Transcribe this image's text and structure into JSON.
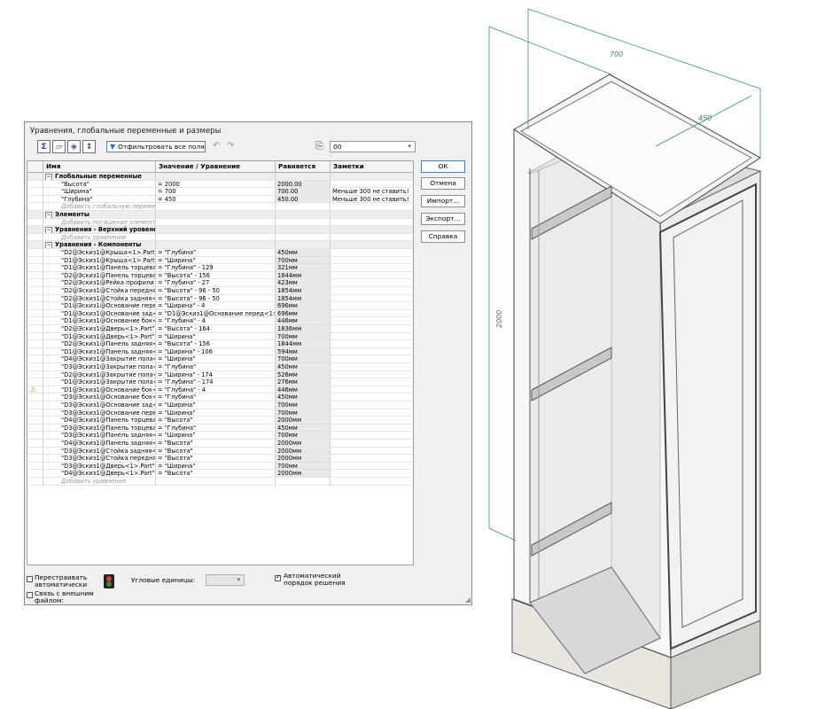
{
  "viewport": {
    "dim_width": "700",
    "dim_depth": "450",
    "dim_height": "2000",
    "accent_color": "#3a8a8a"
  },
  "dialog": {
    "title": "Уравнения, глобальные переменные и размеры",
    "toolbar": {
      "view_equations_icon": "sigma-icon",
      "view_sketch_icon": "sketch-view-icon",
      "view_dims_icon": "dimension-view-icon",
      "view_order_icon": "order-view-icon",
      "filter_label": "Отфильтровать все поля",
      "undo_icon": "undo-icon",
      "redo_icon": "redo-icon",
      "units_icon": "units-icon",
      "units_value": "00"
    },
    "columns": {
      "name": "Имя",
      "value": "Значение / Уравнение",
      "evaluates": "Равняется",
      "notes": "Заметки"
    },
    "rows": [
      {
        "type": "section",
        "name": "Глобальные переменные",
        "value": "",
        "eval": "",
        "notes": ""
      },
      {
        "type": "row",
        "name": "\"Высота\"",
        "value": "= 2000",
        "eval": "2000.00",
        "notes": ""
      },
      {
        "type": "row",
        "name": "\"Ширина\"",
        "value": "= 700",
        "eval": "700.00",
        "notes": "Меньше 300 не ставить!"
      },
      {
        "type": "row",
        "name": "\"Глубина\"",
        "value": "= 450",
        "eval": "450.00",
        "notes": "Меньше 300 не ставить!"
      },
      {
        "type": "add",
        "name": "Добавить глобальную перемен",
        "value": "",
        "eval": "",
        "notes": ""
      },
      {
        "type": "section",
        "name": "Элементы",
        "value": "",
        "eval": "",
        "notes": ""
      },
      {
        "type": "add",
        "name": "Добавить погашение элемента",
        "value": "",
        "eval": "",
        "notes": ""
      },
      {
        "type": "section",
        "name": "Уравнения - Верхний уровень",
        "value": "",
        "eval": "",
        "notes": ""
      },
      {
        "type": "add",
        "name": "Добавить уравнение",
        "value": "",
        "eval": "",
        "notes": ""
      },
      {
        "type": "section",
        "name": "Уравнения - Компоненты",
        "value": "",
        "eval": "",
        "notes": ""
      },
      {
        "type": "row",
        "name": "\"D2@Эскиз1@Крыша<1>.Part@",
        "value": "= \"Глубина\"",
        "eval": "450мм",
        "notes": ""
      },
      {
        "type": "row",
        "name": "\"D1@Эскиз1@Крыша<1>.Part@",
        "value": "= \"Ширина\"",
        "eval": "700мм",
        "notes": ""
      },
      {
        "type": "row",
        "name": "\"D1@Эскиз1@Панель торцева",
        "value": "= \"Глубина\" - 129",
        "eval": "321мм",
        "notes": ""
      },
      {
        "type": "row",
        "name": "\"D2@Эскиз1@Панель торцева",
        "value": "= \"Высота\" - 156",
        "eval": "1844мм",
        "notes": ""
      },
      {
        "type": "row",
        "name": "\"D2@Эскиз1@Рейка профили",
        "value": "= \"Глубина\" - 27",
        "eval": "423мм",
        "notes": ""
      },
      {
        "type": "row",
        "name": "\"D2@Эскиз1@Стойка передня",
        "value": "= \"Высота\" - 96 - 50",
        "eval": "1854мм",
        "notes": ""
      },
      {
        "type": "row",
        "name": "\"D2@Эскиз1@Стойка задняя<",
        "value": "= \"Высота\" - 96 - 50",
        "eval": "1854мм",
        "notes": ""
      },
      {
        "type": "row",
        "name": "\"D1@Эскиз1@Основание пере",
        "value": "= \"Ширина\" - 4",
        "eval": "696мм",
        "notes": ""
      },
      {
        "type": "row",
        "name": "\"D1@Эскиз1@Основание зад<",
        "value": "= \"D1@Эскиз1@Основание перед<1>.",
        "eval": "696мм",
        "notes": ""
      },
      {
        "type": "row",
        "name": "\"D1@Эскиз1@Основание бок<",
        "value": "= \"Глубина\" - 4",
        "eval": "446мм",
        "notes": ""
      },
      {
        "type": "row",
        "name": "\"D2@Эскиз1@Дверь<1>.Part\"",
        "value": "= \"Высота\" - 164",
        "eval": "1836мм",
        "notes": ""
      },
      {
        "type": "row",
        "name": "\"D1@Эскиз1@Дверь<1>.Part\"",
        "value": "= \"Ширина\"",
        "eval": "700мм",
        "notes": ""
      },
      {
        "type": "row",
        "name": "\"D2@Эскиз1@Панель задняя<",
        "value": "= \"Высота\" - 156",
        "eval": "1844мм",
        "notes": ""
      },
      {
        "type": "row",
        "name": "\"D1@Эскиз1@Панель задняя<",
        "value": "= \"Ширина\" - 106",
        "eval": "594мм",
        "notes": ""
      },
      {
        "type": "row",
        "name": "\"D4@Эскиз1@Закрытие пола<",
        "value": "= \"Ширина\"",
        "eval": "700мм",
        "notes": ""
      },
      {
        "type": "row",
        "name": "\"D3@Эскиз1@Закрытие пола<",
        "value": "= \"Глубина\"",
        "eval": "450мм",
        "notes": ""
      },
      {
        "type": "row",
        "name": "\"D2@Эскиз1@Закрытие пола<",
        "value": "= \"Ширина\" - 174",
        "eval": "526мм",
        "notes": ""
      },
      {
        "type": "row",
        "name": "\"D1@Эскиз1@Закрытие пола<",
        "value": "= \"Глубина\" - 174",
        "eval": "276мм",
        "notes": ""
      },
      {
        "type": "row",
        "warn": true,
        "name": "\"D1@Эскиз1@Основание бок<",
        "value": "= \"Глубина\" - 4",
        "eval": "446мм",
        "notes": ""
      },
      {
        "type": "row",
        "name": "\"D3@Эскиз1@Основание бок<",
        "value": "= \"Глубина\"",
        "eval": "450мм",
        "notes": ""
      },
      {
        "type": "row",
        "name": "\"D3@Эскиз1@Основание зад<",
        "value": "= \"Ширина\"",
        "eval": "700мм",
        "notes": ""
      },
      {
        "type": "row",
        "name": "\"D3@Эскиз1@Основание пере",
        "value": "= \"Ширина\"",
        "eval": "700мм",
        "notes": ""
      },
      {
        "type": "row",
        "name": "\"D4@Эскиз1@Панель торцева",
        "value": "= \"Высота\"",
        "eval": "2000мм",
        "notes": ""
      },
      {
        "type": "row",
        "name": "\"D3@Эскиз1@Панель торцева",
        "value": "= \"Глубина\"",
        "eval": "450мм",
        "notes": ""
      },
      {
        "type": "row",
        "name": "\"D3@Эскиз1@Панель задняя<",
        "value": "= \"Ширина\"",
        "eval": "700мм",
        "notes": ""
      },
      {
        "type": "row",
        "name": "\"D4@Эскиз1@Панель задняя<",
        "value": "= \"Высота\"",
        "eval": "2000мм",
        "notes": ""
      },
      {
        "type": "row",
        "name": "\"D3@Эскиз1@Стойка задняя<",
        "value": "= \"Высота\"",
        "eval": "2000мм",
        "notes": ""
      },
      {
        "type": "row",
        "name": "\"D3@Эскиз1@Стойка передня",
        "value": "= \"Высота\"",
        "eval": "2000мм",
        "notes": ""
      },
      {
        "type": "row",
        "name": "\"D3@Эскиз1@Дверь<1>.Part\"",
        "value": "= \"Ширина\"",
        "eval": "700мм",
        "notes": ""
      },
      {
        "type": "row",
        "name": "\"D4@Эскиз1@Дверь<1>.Part\"",
        "value": "= \"Высота\"",
        "eval": "2000мм",
        "notes": ""
      },
      {
        "type": "add",
        "name": "Добавить уравнение",
        "value": "",
        "eval": "",
        "notes": ""
      }
    ],
    "buttons": {
      "ok": "ОК",
      "cancel": "Отмена",
      "import": "Импорт...",
      "export": "Экспорт...",
      "help": "Справка"
    },
    "bottom": {
      "auto_rebuild_line1": "Перестраивать",
      "auto_rebuild_line2": "автоматически",
      "link_file_line1": "Связь с внешним",
      "link_file_line2": "файлом:",
      "angle_units_label": "Угловые единицы:",
      "auto_order_line1": "Автоматический",
      "auto_order_line2": "порядок решения",
      "auto_rebuild_checked": false,
      "link_file_checked": false,
      "auto_order_checked": true
    }
  }
}
